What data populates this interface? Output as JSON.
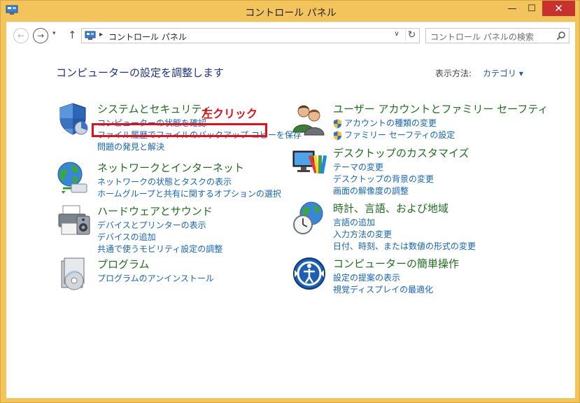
{
  "window": {
    "title": "コントロール パネル",
    "minimize_glyph": "—",
    "maximize_glyph": "☐",
    "close_glyph": "✕"
  },
  "nav": {
    "back_glyph": "←",
    "forward_glyph": "→",
    "recent_glyph": "▾",
    "up_glyph": "↑",
    "address_separator": "▸",
    "address": "コントロール パネル",
    "dropdown_glyph": "∨",
    "refresh_glyph": "↻",
    "search_placeholder": "コントロール パネルの検索"
  },
  "main": {
    "heading": "コンピューターの設定を調整します",
    "view_by_label": "表示方法:",
    "view_by_value": "カテゴリ ▾"
  },
  "annotation": "左クリック",
  "categories": {
    "system": {
      "icon": "security-shield-icon",
      "title": "システムとセキュリティ",
      "links": [
        "コンピューターの状態を確認",
        "ファイル履歴でファイルのバックアップ コピーを保存",
        "問題の発見と解決"
      ]
    },
    "network": {
      "icon": "network-globe-icon",
      "title": "ネットワークとインターネット",
      "links": [
        "ネットワークの状態とタスクの表示",
        "ホームグループと共有に関するオプションの選択"
      ]
    },
    "hardware": {
      "icon": "printer-icon",
      "title": "ハードウェアとサウンド",
      "links": [
        "デバイスとプリンターの表示",
        "デバイスの追加",
        "共通で使うモビリティ設定の調整"
      ]
    },
    "programs": {
      "icon": "programs-disc-icon",
      "title": "プログラム",
      "links": [
        "プログラムのアンインストール"
      ]
    },
    "users": {
      "icon": "users-icon",
      "title": "ユーザー アカウントとファミリー セーフティ",
      "links": [
        "アカウントの種類の変更",
        "ファミリー セーフティの設定"
      ]
    },
    "appearance": {
      "icon": "monitor-palette-icon",
      "title": "デスクトップのカスタマイズ",
      "links": [
        "テーマの変更",
        "デスクトップの背景の変更",
        "画面の解像度の調整"
      ]
    },
    "clock": {
      "icon": "clock-globe-icon",
      "title": "時計、言語、および地域",
      "links": [
        "言語の追加",
        "入力方法の変更",
        "日付、時刻、または数値の形式の変更"
      ]
    },
    "ease": {
      "icon": "ease-of-access-icon",
      "title": "コンピューターの簡単操作",
      "links": [
        "設定の提案の表示",
        "視覚ディスプレイの最適化"
      ]
    }
  },
  "colors": {
    "frame": "#f3c45c",
    "heading": "#1e3287",
    "category_title": "#1f6e1f",
    "link": "#1664b5",
    "annotation": "#e2101c",
    "close_button": "#c7322f"
  }
}
